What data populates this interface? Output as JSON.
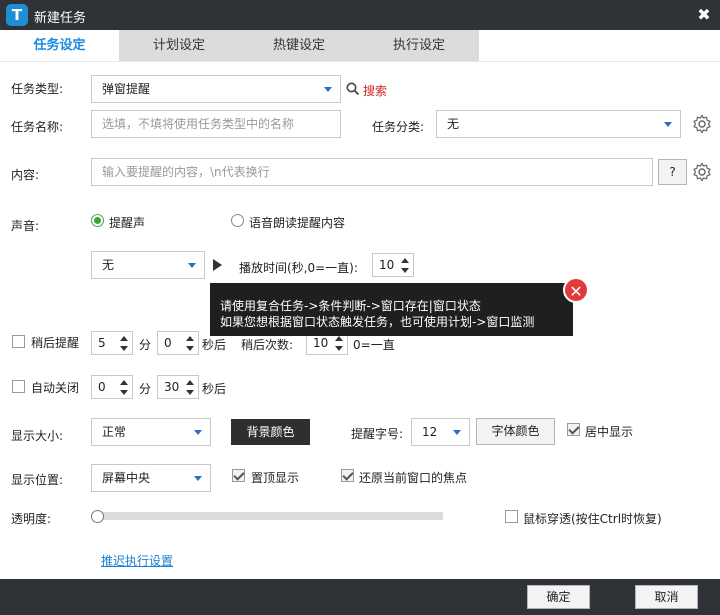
{
  "window": {
    "title": "新建任务",
    "logo_letter": "T",
    "close_glyph": "✖"
  },
  "tabs": [
    {
      "label": "任务设定"
    },
    {
      "label": "计划设定"
    },
    {
      "label": "热键设定"
    },
    {
      "label": "执行设定"
    }
  ],
  "task_type": {
    "label": "任务类型:",
    "value": "弹窗提醒",
    "search_label": "搜索"
  },
  "task_name": {
    "label": "任务名称:",
    "placeholder": "选填，不填将使用任务类型中的名称"
  },
  "task_category": {
    "label": "任务分类:",
    "value": "无"
  },
  "content": {
    "label": "内容:",
    "placeholder": "输入要提醒的内容，\\n代表换行",
    "help_label": "?"
  },
  "sound": {
    "label": "声音:",
    "option_alert": "提醒声",
    "option_tts": "语音朗读提醒内容",
    "selected": "提醒声",
    "sound_select": "无",
    "play_time_label": "播放时间(秒,0=一直):",
    "play_time_value": "10"
  },
  "tooltip": {
    "line1": "请使用复合任务->条件判断->窗口存在|窗口状态",
    "line2": "如果您想根据窗口状态触发任务，也可使用计划->窗口监测",
    "close_glyph": "✕"
  },
  "snooze": {
    "label": "稍后提醒",
    "checked": false,
    "minutes": "5",
    "min_unit": "分",
    "seconds": "0",
    "sec_unit": "秒后",
    "count_label": "稍后次数:",
    "count_value": "10",
    "count_hint": "0=一直"
  },
  "auto_close": {
    "label": "自动关闭",
    "checked": false,
    "minutes": "0",
    "min_unit": "分",
    "seconds": "30",
    "sec_unit": "秒后"
  },
  "display_size": {
    "label": "显示大小:",
    "value": "正常",
    "bg_color_button": "背景颜色",
    "font_size_label": "提醒字号:",
    "font_size_value": "12",
    "font_color_button": "字体颜色",
    "center_label": "居中显示",
    "center_checked": true
  },
  "display_position": {
    "label": "显示位置:",
    "value": "屏幕中央",
    "topmost_label": "置顶显示",
    "topmost_checked": true,
    "restore_focus_label": "还原当前窗口的焦点",
    "restore_focus_checked": true
  },
  "transparency": {
    "label": "透明度:",
    "level_fraction": 0,
    "click_through_label": "鼠标穿透(按住Ctrl时恢复)",
    "click_through_checked": false
  },
  "defer_link": "推迟执行设置",
  "footer": {
    "ok_label": "确定",
    "cancel_label": "取消"
  },
  "colors": {
    "accent": "#1a8be0",
    "titlebar": "#2f3338",
    "search_red": "#d42020",
    "radio_green": "#3aa63a",
    "tooltip_bg": "#1f1f1f",
    "tooltip_close": "#e13a3a"
  }
}
